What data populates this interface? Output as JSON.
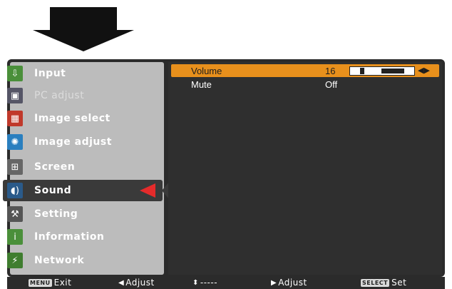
{
  "sidebar": {
    "items": [
      {
        "label": "Input",
        "icon": "input-icon",
        "state": "normal"
      },
      {
        "label": "PC adjust",
        "icon": "pc-adjust-icon",
        "state": "disabled"
      },
      {
        "label": "Image select",
        "icon": "image-select-icon",
        "state": "normal"
      },
      {
        "label": "Image adjust",
        "icon": "image-adjust-icon",
        "state": "normal"
      },
      {
        "label": "Screen",
        "icon": "screen-icon",
        "state": "normal"
      },
      {
        "label": "Sound",
        "icon": "sound-icon",
        "state": "active"
      },
      {
        "label": "Setting",
        "icon": "setting-icon",
        "state": "normal"
      },
      {
        "label": "Information",
        "icon": "information-icon",
        "state": "normal"
      },
      {
        "label": "Network",
        "icon": "network-icon",
        "state": "normal"
      }
    ]
  },
  "content": {
    "rows": [
      {
        "name": "Volume",
        "value": "16",
        "highlighted": true,
        "level_fraction": 0.5
      },
      {
        "name": "Mute",
        "value": "Off",
        "highlighted": false
      }
    ]
  },
  "footer": {
    "exit_key": "MENU",
    "exit_label": "Exit",
    "adjust_left_label": "Adjust",
    "updown_label": "-----",
    "adjust_right_label": "Adjust",
    "set_key": "SELECT",
    "set_label": "Set"
  },
  "colors": {
    "highlight": "#e8901c",
    "pointer": "#e52b2b",
    "panel": "#2f2f2f",
    "sidebar": "#bcbcbc"
  }
}
